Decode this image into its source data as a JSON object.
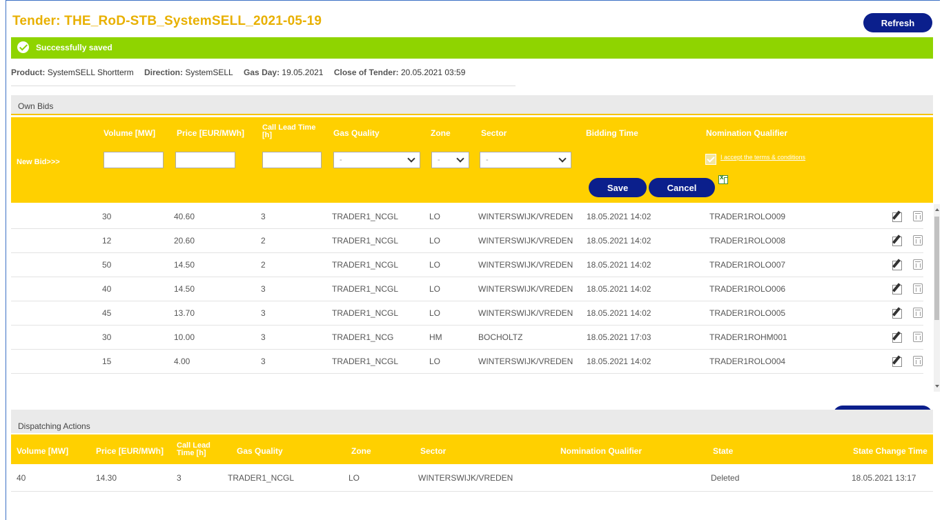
{
  "header": {
    "title": "Tender: THE_RoD-STB_SystemSELL_2021-05-19",
    "refresh_label": "Refresh"
  },
  "notification": {
    "message": "Successfully saved"
  },
  "info": {
    "product_label": "Product:",
    "product_value": "SystemSELL Shortterm",
    "direction_label": "Direction:",
    "direction_value": "SystemSELL",
    "gasday_label": "Gas Day:",
    "gasday_value": "19.05.2021",
    "close_label": "Close of Tender:",
    "close_value": "20.05.2021 03:59"
  },
  "own_bids": {
    "section_title": "Own Bids",
    "headers": {
      "volume": "Volume [MW]",
      "price": "Price [EUR/MWh]",
      "call_lead_1": "Call Lead Time",
      "call_lead_2": "[h]",
      "gas_quality": "Gas Quality",
      "zone": "Zone",
      "sector": "Sector",
      "bidding_time": "Bidding Time",
      "nomination": "Nomination Qualifier"
    },
    "new_bid_label": "New Bid>>>",
    "gas_quality_value": "-",
    "zone_value": "-",
    "sector_value": "-",
    "terms_label": "I accept the terms & conditions",
    "save_label": "Save",
    "cancel_label": "Cancel",
    "rows": [
      {
        "volume": "30",
        "price": "40.60",
        "clt": "3",
        "gas": "TRADER1_NCGL",
        "zone": "LO",
        "sector": "WINTERSWIJK/VREDEN",
        "time": "18.05.2021 14:02",
        "nom": "TRADER1ROLO009"
      },
      {
        "volume": "12",
        "price": "20.60",
        "clt": "2",
        "gas": "TRADER1_NCGL",
        "zone": "LO",
        "sector": "WINTERSWIJK/VREDEN",
        "time": "18.05.2021 14:02",
        "nom": "TRADER1ROLO008"
      },
      {
        "volume": "50",
        "price": "14.50",
        "clt": "2",
        "gas": "TRADER1_NCGL",
        "zone": "LO",
        "sector": "WINTERSWIJK/VREDEN",
        "time": "18.05.2021 14:02",
        "nom": "TRADER1ROLO007"
      },
      {
        "volume": "40",
        "price": "14.50",
        "clt": "3",
        "gas": "TRADER1_NCGL",
        "zone": "LO",
        "sector": "WINTERSWIJK/VREDEN",
        "time": "18.05.2021 14:02",
        "nom": "TRADER1ROLO006"
      },
      {
        "volume": "45",
        "price": "13.70",
        "clt": "3",
        "gas": "TRADER1_NCGL",
        "zone": "LO",
        "sector": "WINTERSWIJK/VREDEN",
        "time": "18.05.2021 14:02",
        "nom": "TRADER1ROLO005"
      },
      {
        "volume": "30",
        "price": "10.00",
        "clt": "3",
        "gas": "TRADER1_NCG",
        "zone": "HM",
        "sector": "BOCHOLTZ",
        "time": "18.05.2021 17:03",
        "nom": "TRADER1ROHM001"
      },
      {
        "volume": "15",
        "price": "4.00",
        "clt": "3",
        "gas": "TRADER1_NCGL",
        "zone": "LO",
        "sector": "WINTERSWIJK/VREDEN",
        "time": "18.05.2021 14:02",
        "nom": "TRADER1ROLO004"
      }
    ],
    "csv_label": "CSV Download"
  },
  "dispatching": {
    "section_title": "Dispatching Actions",
    "headers": {
      "volume": "Volume [MW]",
      "price": "Price [EUR/MWh]",
      "call_lead_1": "Call Lead",
      "call_lead_2": "Time [h]",
      "gas_quality": "Gas Quality",
      "zone": "Zone",
      "sector": "Sector",
      "nomination": "Nomination Qualifier",
      "state": "State",
      "state_change": "State Change Time"
    },
    "rows": [
      {
        "volume": "40",
        "price": "14.30",
        "clt": "3",
        "gas": "TRADER1_NCGL",
        "zone": "LO",
        "sector": "WINTERSWIJK/VREDEN",
        "nom": "",
        "state": "Deleted",
        "state_time": "18.05.2021 13:17"
      }
    ]
  },
  "colors": {
    "accent_yellow": "#ffd000",
    "title_color": "#e8b000",
    "button_blue": "#0b1f8c",
    "success_green": "#8fd400"
  }
}
